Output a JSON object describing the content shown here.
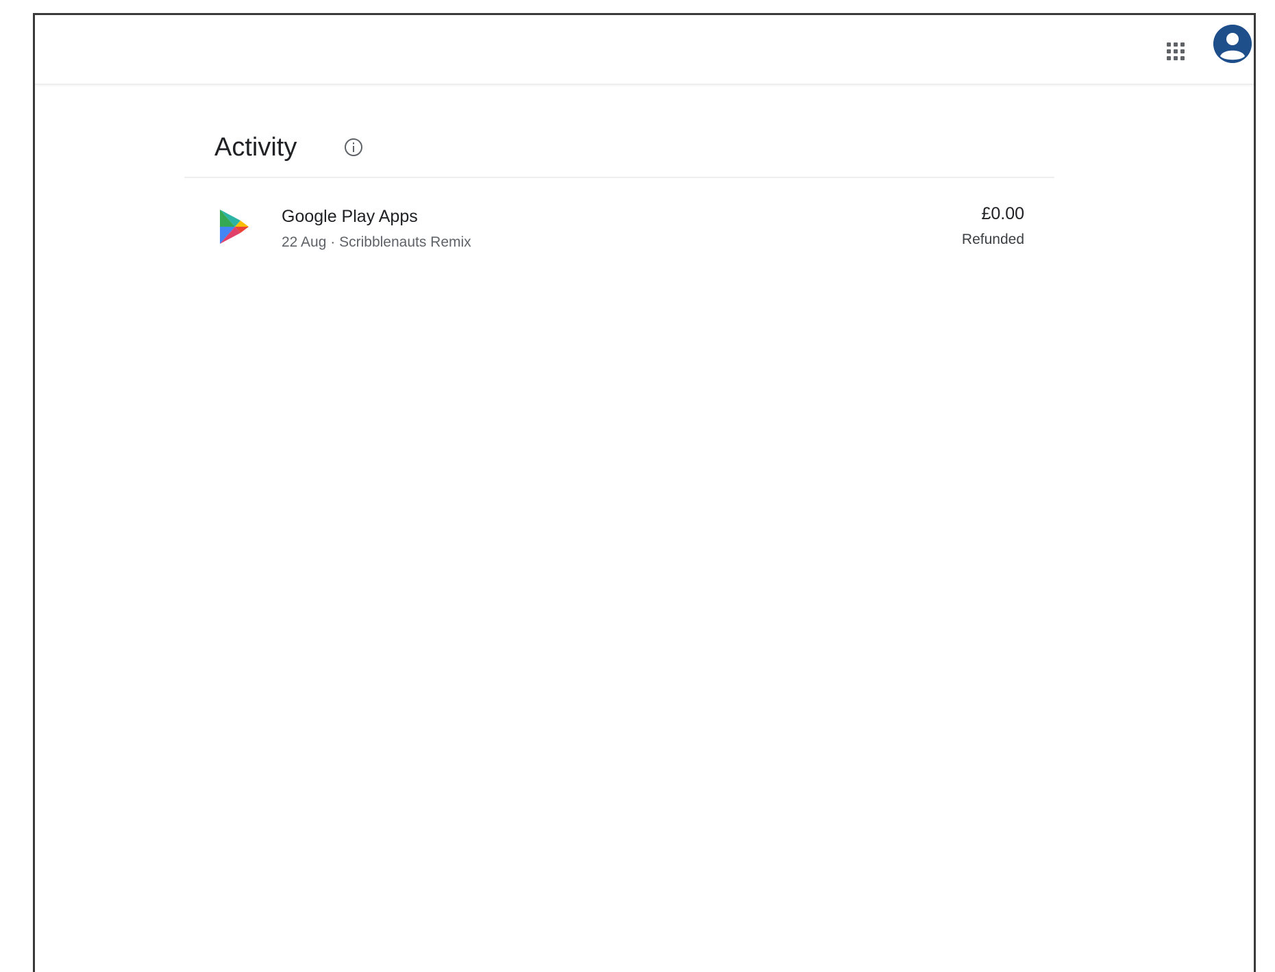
{
  "header": {
    "apps_icon": "apps-grid-icon",
    "avatar_icon": "account-avatar-icon"
  },
  "activity": {
    "title": "Activity",
    "info_icon": "info-icon",
    "items": [
      {
        "icon": "google-play-icon",
        "title": "Google Play Apps",
        "date": "22 Aug",
        "separator": "·",
        "description": "Scribblenauts Remix",
        "amount": "£0.00",
        "status": "Refunded"
      }
    ]
  },
  "colors": {
    "avatar_bg": "#1f4f8b",
    "text_primary": "#202124",
    "text_secondary": "#5f6368",
    "divider": "#eeeeee"
  }
}
